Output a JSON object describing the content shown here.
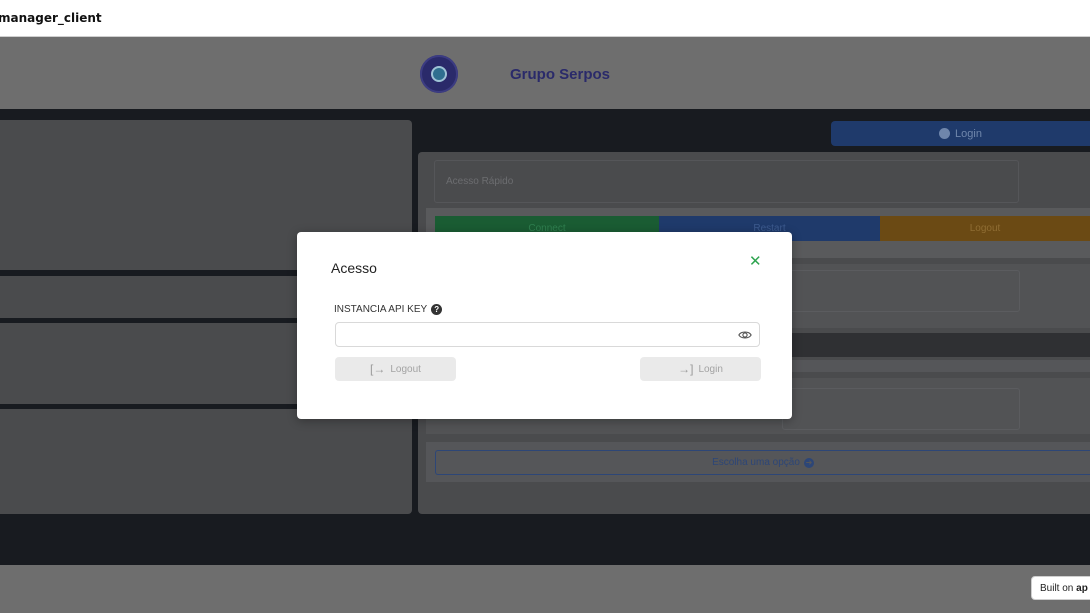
{
  "window": {
    "title": "manager_client"
  },
  "header": {
    "brand": "Grupo Serpos",
    "logo_icon": "globe-clock-logo"
  },
  "top_login": {
    "label": "Login",
    "icon": "user-circle-icon"
  },
  "quick_access": {
    "title": "Acesso Rápido",
    "buttons": [
      {
        "label": "Connect",
        "color": "#1a5c33"
      },
      {
        "label": "Restart",
        "color": "#1f3a6b"
      },
      {
        "label": "Logout",
        "color": "#6b4a14"
      }
    ]
  },
  "choose": {
    "label": "Escolha uma opção",
    "icon": "arrow-circle-right-icon"
  },
  "footer": {
    "built_prefix": "Built on",
    "built_brand": "ap"
  },
  "modal": {
    "title": "Acesso",
    "close_icon": "close-x-icon",
    "field_label": "INSTANCIA API KEY",
    "help_icon": "question-circle-icon",
    "input_value": "",
    "input_placeholder": "",
    "eye_icon": "eye-icon",
    "logout_label": "Logout",
    "logout_icon": "sign-out-icon",
    "login_label": "Login",
    "login_icon": "sign-in-icon"
  },
  "colors": {
    "accent_green": "#2ea44f",
    "brand": "#2a2a6a"
  }
}
